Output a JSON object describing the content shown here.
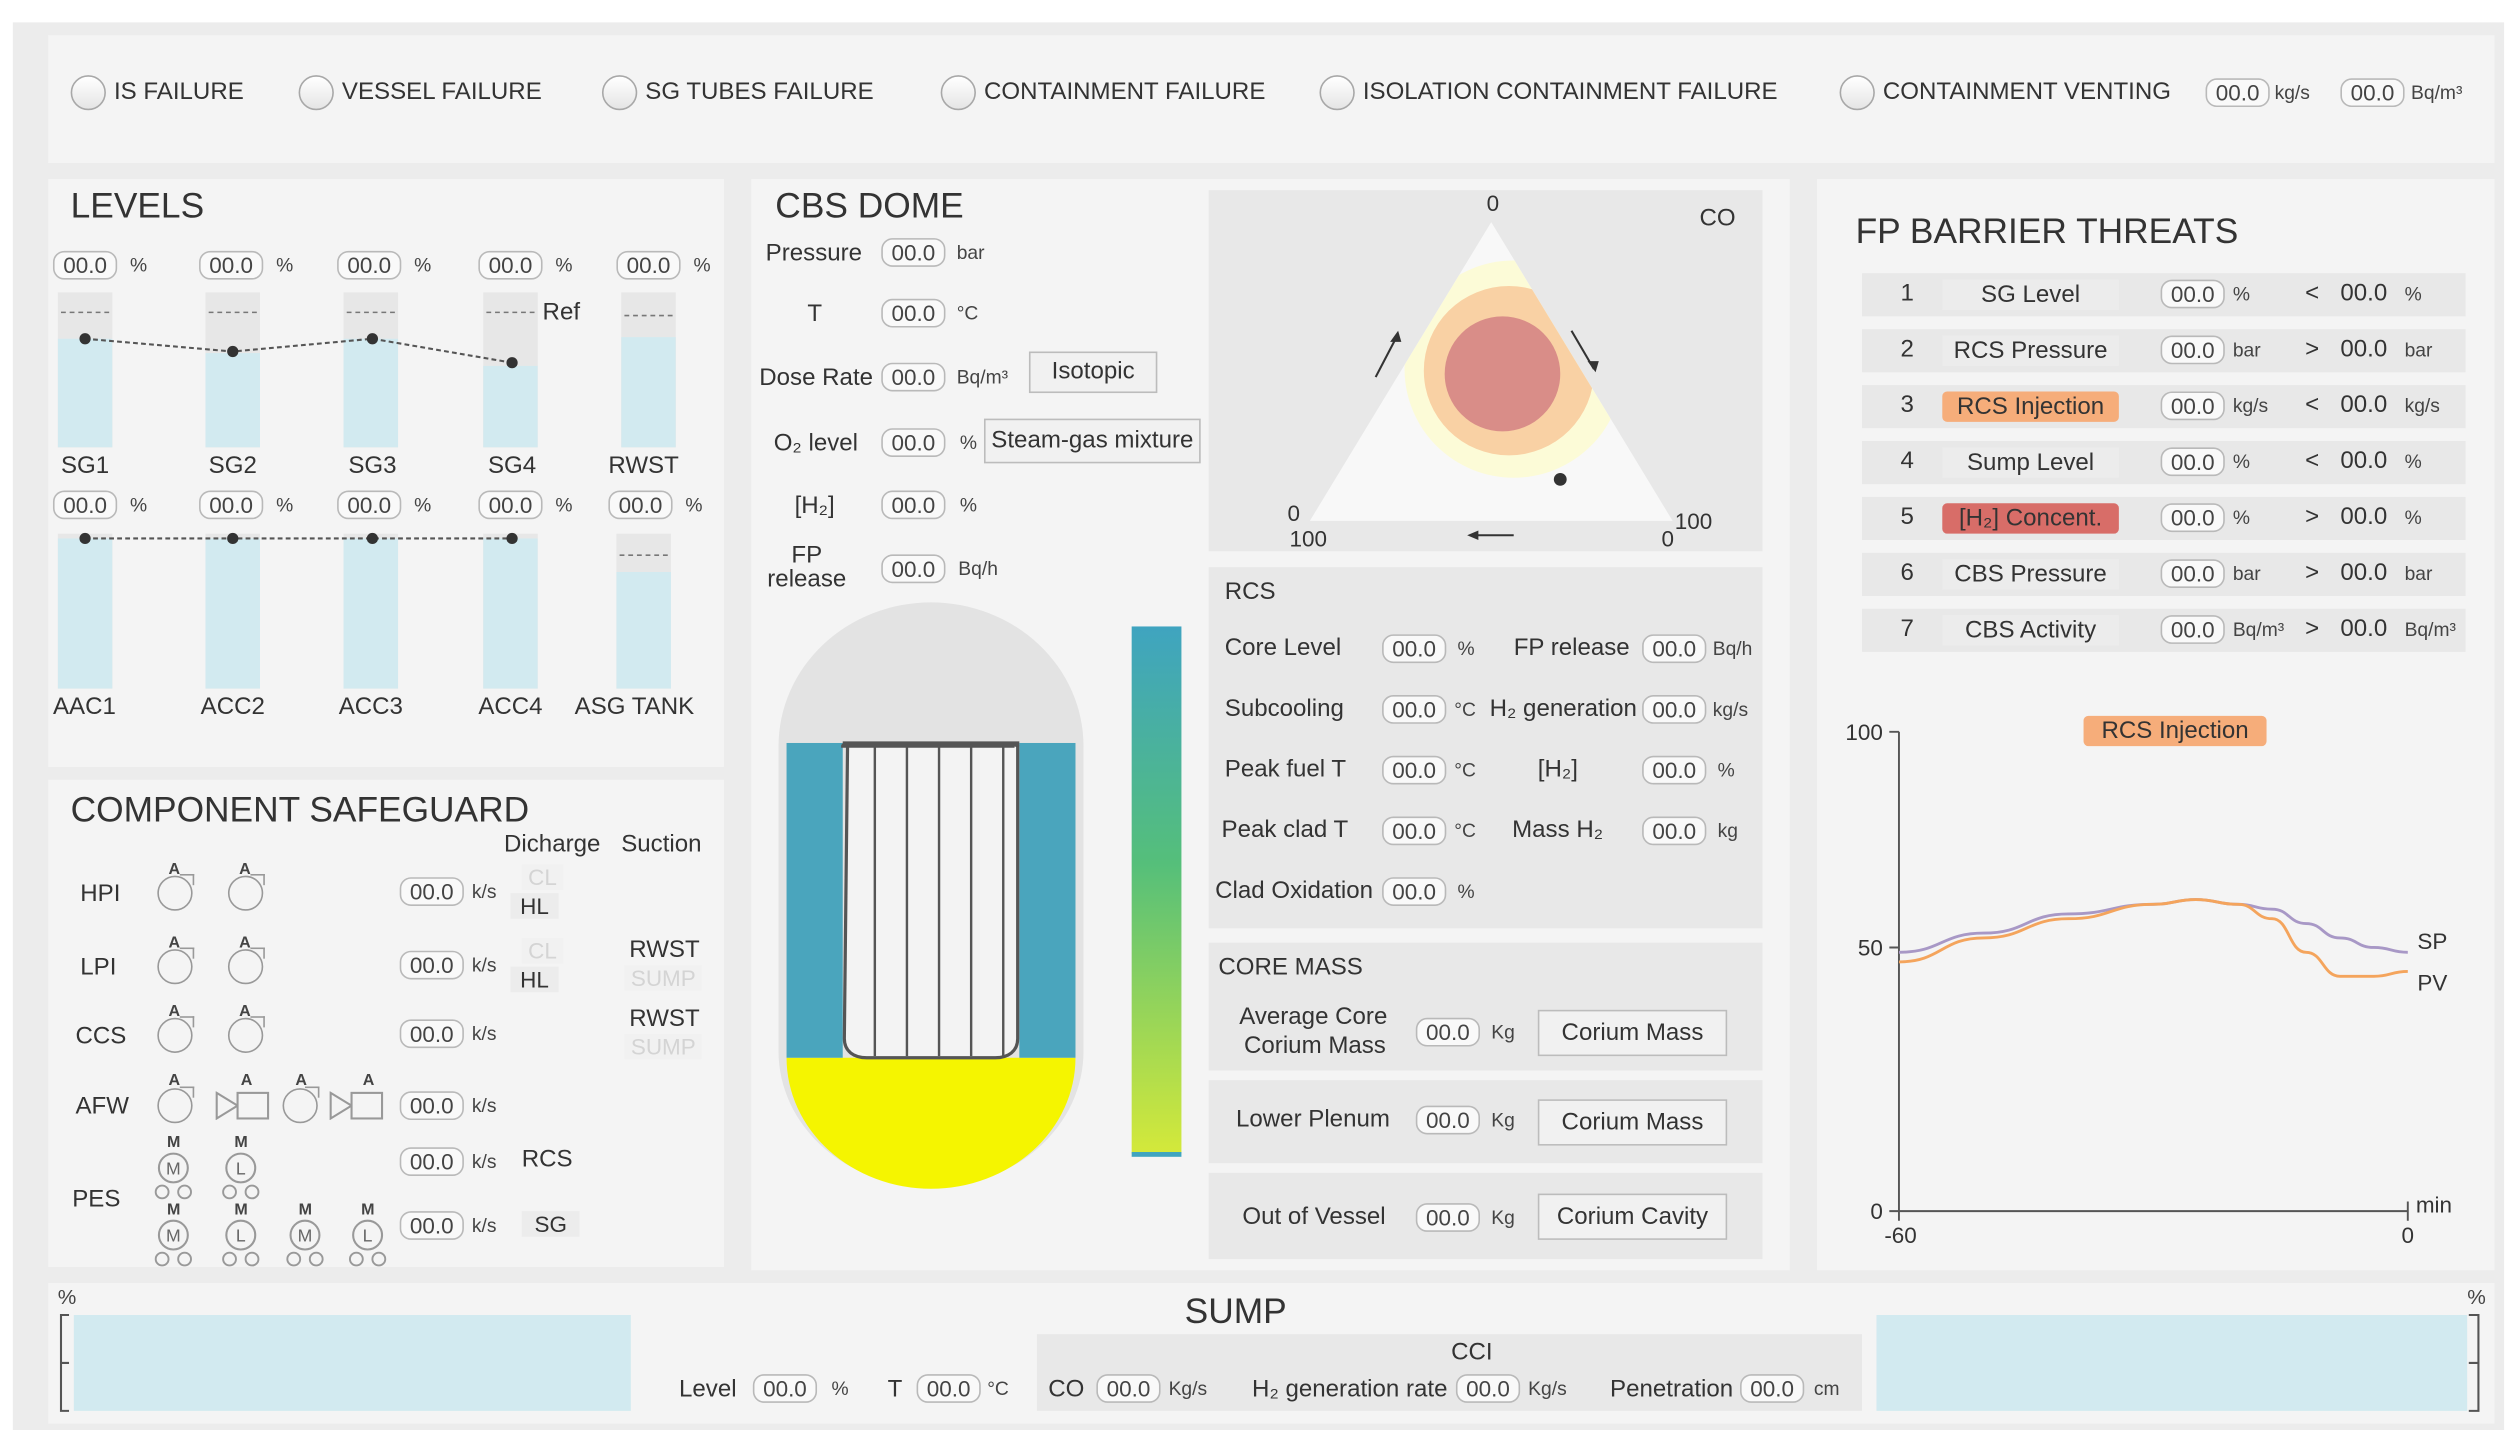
{
  "failures": [
    {
      "label": "IS FAILURE"
    },
    {
      "label": "VESSEL FAILURE"
    },
    {
      "label": "SG TUBES FAILURE"
    },
    {
      "label": "CONTAINMENT FAILURE"
    },
    {
      "label": "ISOLATION CONTAINMENT FAILURE"
    },
    {
      "label": "CONTAINMENT VENTING"
    }
  ],
  "venting": {
    "flow_value": "00.0",
    "flow_unit": "kg/s",
    "act_value": "00.0",
    "act_unit": "Bq/m³"
  },
  "levels": {
    "title": "LEVELS",
    "row1": [
      {
        "name": "SG1",
        "value": "00.0",
        "unit": "%",
        "fill_pct": 70
      },
      {
        "name": "SG2",
        "value": "00.0",
        "unit": "%",
        "fill_pct": 61
      },
      {
        "name": "SG3",
        "value": "00.0",
        "unit": "%",
        "fill_pct": 70
      },
      {
        "name": "SG4",
        "value": "00.0",
        "unit": "%",
        "fill_pct": 53
      },
      {
        "name": "RWST",
        "value": "00.0",
        "unit": "%",
        "fill_pct": 71
      }
    ],
    "ref_label": "Ref",
    "row2": [
      {
        "name": "AAC1",
        "value": "00.0",
        "unit": "%",
        "fill_pct": 97
      },
      {
        "name": "ACC2",
        "value": "00.0",
        "unit": "%",
        "fill_pct": 97
      },
      {
        "name": "ACC3",
        "value": "00.0",
        "unit": "%",
        "fill_pct": 97
      },
      {
        "name": "ACC4",
        "value": "00.0",
        "unit": "%",
        "fill_pct": 97
      },
      {
        "name": "ASG TANK",
        "value": "00.0",
        "unit": "%",
        "fill_pct": 75
      }
    ]
  },
  "safeguard": {
    "title": "COMPONENT SAFEGUARD",
    "col_discharge": "Dicharge",
    "col_suction": "Suction",
    "tag_a": "A",
    "tag_m": "M",
    "mot_m": "M",
    "mot_l": "L",
    "rows": [
      {
        "name": "HPI",
        "value": "00.0",
        "unit": "k/s",
        "opt_dim": "CL",
        "opt_sel": "HL"
      },
      {
        "name": "LPI",
        "value": "00.0",
        "unit": "k/s",
        "opt_dim": "CL",
        "opt_sel": "HL",
        "suction_sel": "RWST",
        "suction_dim": "SUMP"
      },
      {
        "name": "CCS",
        "value": "00.0",
        "unit": "k/s",
        "suction_sel": "RWST",
        "suction_dim": "SUMP"
      },
      {
        "name": "AFW",
        "value": "00.0",
        "unit": "k/s"
      },
      {
        "name": "PES",
        "value1": "00.0",
        "unit1": "k/s",
        "target1": "RCS",
        "value2": "00.0",
        "unit2": "k/s",
        "target2": "SG"
      }
    ]
  },
  "cbs": {
    "title": "CBS DOME",
    "pressure": {
      "label": "Pressure",
      "value": "00.0",
      "unit": "bar"
    },
    "temp": {
      "label": "T",
      "value": "00.0",
      "unit": "°C"
    },
    "dose": {
      "label": "Dose Rate",
      "value": "00.0",
      "unit": "Bq/m³",
      "button": "Isotopic"
    },
    "o2": {
      "label": "O₂ level",
      "value": "00.0",
      "unit": "%",
      "button": "Steam-gas mixture"
    },
    "h2": {
      "label": "[H₂]",
      "value": "00.0",
      "unit": "%"
    },
    "fp": {
      "label1": "FP",
      "label2": "release",
      "value": "00.0",
      "unit": "Bq/h"
    }
  },
  "ternary": {
    "corner_label": "CO",
    "top": "0",
    "left_a": "0",
    "left_b": "100",
    "right_a": "100",
    "right_b": "0"
  },
  "rcs": {
    "title": "RCS",
    "core_level": {
      "label": "Core Level",
      "value": "00.0",
      "unit": "%"
    },
    "fp_release": {
      "label": "FP release",
      "value": "00.0",
      "unit": "Bq/h"
    },
    "subcooling": {
      "label": "Subcooling",
      "value": "00.0",
      "unit": "°C"
    },
    "h2_gen": {
      "label": "H₂ generation",
      "value": "00.0",
      "unit": "kg/s"
    },
    "peak_fuel": {
      "label": "Peak fuel T",
      "value": "00.0",
      "unit": "°C"
    },
    "h2_conc": {
      "label": "[H₂]",
      "value": "00.0",
      "unit": "%"
    },
    "peak_clad": {
      "label": "Peak clad T",
      "value": "00.0",
      "unit": "°C"
    },
    "mass_h2": {
      "label": "Mass H₂",
      "value": "00.0",
      "unit": "kg"
    },
    "clad_ox": {
      "label": "Clad Oxidation",
      "value": "00.0",
      "unit": "%"
    }
  },
  "core_mass": {
    "title": "CORE MASS",
    "avg_label1": "Average Core",
    "avg_label2": "Corium Mass",
    "avg_value": "00.0",
    "avg_unit": "Kg",
    "avg_button": "Corium Mass",
    "lp_label": "Lower Plenum",
    "lp_value": "00.0",
    "lp_unit": "Kg",
    "lp_button": "Corium Mass",
    "ov_label": "Out of Vessel",
    "ov_value": "00.0",
    "ov_unit": "Kg",
    "ov_button": "Corium Cavity"
  },
  "threats": {
    "title": "FP BARRIER THREATS",
    "rows": [
      {
        "num": "1",
        "name": "SG Level",
        "value": "00.0",
        "unit": "%",
        "op": "<",
        "limit": "00.0",
        "limit_unit": "%",
        "highlight": ""
      },
      {
        "num": "2",
        "name": "RCS Pressure",
        "value": "00.0",
        "unit": "bar",
        "op": ">",
        "limit": "00.0",
        "limit_unit": "bar",
        "highlight": ""
      },
      {
        "num": "3",
        "name": "RCS Injection",
        "value": "00.0",
        "unit": "kg/s",
        "op": "<",
        "limit": "00.0",
        "limit_unit": "kg/s",
        "highlight": "#f6ad7a"
      },
      {
        "num": "4",
        "name": "Sump Level",
        "value": "00.0",
        "unit": "%",
        "op": "<",
        "limit": "00.0",
        "limit_unit": "%",
        "highlight": ""
      },
      {
        "num": "5",
        "name": "[H₂] Concent.",
        "value": "00.0",
        "unit": "%",
        "op": ">",
        "limit": "00.0",
        "limit_unit": "%",
        "highlight": "#d86d68"
      },
      {
        "num": "6",
        "name": "CBS Pressure",
        "value": "00.0",
        "unit": "bar",
        "op": ">",
        "limit": "00.0",
        "limit_unit": "bar",
        "highlight": ""
      },
      {
        "num": "7",
        "name": "CBS Activity",
        "value": "00.0",
        "unit": "Bq/m³",
        "op": ">",
        "limit": "00.0",
        "limit_unit": "Bq/m³",
        "highlight": ""
      }
    ]
  },
  "chart_data": {
    "type": "line",
    "title": "RCS Injection",
    "xlabel": "min",
    "ylabel": "",
    "xlim": [
      -60,
      0
    ],
    "ylim": [
      0,
      100
    ],
    "x_ticks": [
      "-60",
      "0"
    ],
    "y_ticks": [
      "100",
      "50",
      "0"
    ],
    "series": [
      {
        "name": "SP",
        "color": "#a898c6",
        "x": [
          -60,
          -50,
          -40,
          -30,
          -25,
          -20,
          -16,
          -12,
          -8,
          -4,
          0
        ],
        "y": [
          54,
          58,
          62,
          64,
          65,
          64,
          63,
          60,
          57,
          55,
          54
        ]
      },
      {
        "name": "PV",
        "color": "#f4a45c",
        "x": [
          -60,
          -50,
          -40,
          -30,
          -25,
          -20,
          -16,
          -12,
          -8,
          -4,
          0
        ],
        "y": [
          52,
          57,
          61,
          64,
          65,
          64,
          61,
          54,
          49,
          49,
          50
        ]
      }
    ]
  },
  "sump": {
    "title": "SUMP",
    "pct_left": "%",
    "pct_right": "%",
    "level": {
      "label": "Level",
      "value": "00.0",
      "unit": "%"
    },
    "temp": {
      "label": "T",
      "value": "00.0",
      "unit": "°C"
    },
    "cci_label": "CCI",
    "co": {
      "label": "CO",
      "value": "00.0",
      "unit": "Kg/s"
    },
    "h2rate": {
      "label": "H₂ generation rate",
      "value": "00.0",
      "unit": "Kg/s"
    },
    "penetration": {
      "label": "Penetration",
      "value": "00.0",
      "unit": "cm"
    }
  }
}
